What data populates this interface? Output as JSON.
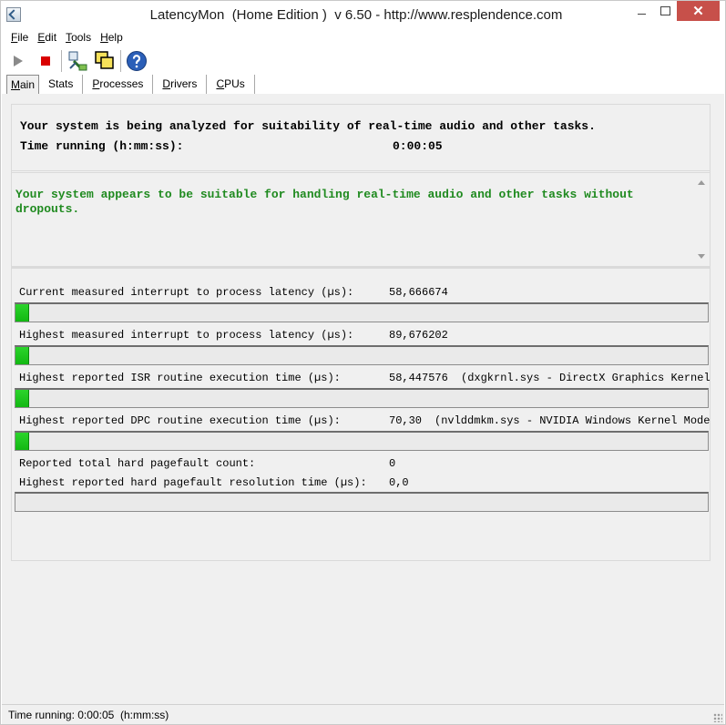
{
  "window": {
    "title": "LatencyMon  (Home Edition )  v 6.50 - http://www.resplendence.com",
    "close_label": "✕"
  },
  "menu": [
    {
      "underline": "F",
      "rest": "ile"
    },
    {
      "underline": "E",
      "rest": "dit"
    },
    {
      "underline": "T",
      "rest": "ools"
    },
    {
      "underline": "H",
      "rest": "elp"
    }
  ],
  "toolbar": {
    "icons": [
      "play-icon",
      "stop-icon",
      "connection-icon",
      "windows-icon",
      "help-icon"
    ],
    "stop_color": "#d90000"
  },
  "tabs": [
    {
      "underline": "M",
      "rest": "ain",
      "active": true
    },
    {
      "underline": "",
      "rest": "Stats",
      "active": false
    },
    {
      "underline": "P",
      "rest": "rocesses",
      "active": false
    },
    {
      "underline": "D",
      "rest": "rivers",
      "active": false
    },
    {
      "underline": "C",
      "rest": "PUs",
      "active": false
    }
  ],
  "analysis": {
    "line1": "Your system is being analyzed for suitability of real-time audio and other tasks.",
    "time_label": "Time running (h:mm:ss):",
    "time_value": "0:00:05"
  },
  "verdict": {
    "text": "Your system appears to be suitable for handling real-time audio and other tasks without dropouts.",
    "color": "#1f8a1f"
  },
  "metrics": [
    {
      "label": "Current measured interrupt to process latency (µs):",
      "value": "58,666674",
      "detail": "",
      "bar_fraction": 0.02
    },
    {
      "label": "Highest measured interrupt to process latency (µs):",
      "value": "89,676202",
      "detail": "",
      "bar_fraction": 0.02
    },
    {
      "label": "Highest reported ISR routine execution time (µs):",
      "value": "58,447576",
      "detail": "(dxgkrnl.sys - DirectX Graphics Kernel,",
      "bar_fraction": 0.02
    },
    {
      "label": "Highest reported DPC routine execution time (µs):",
      "value": "70,30",
      "detail": "(nvlddmkm.sys - NVIDIA Windows Kernel Mode Driver",
      "bar_fraction": 0.02
    }
  ],
  "pagefault": {
    "count_label": "Reported total hard pagefault count:",
    "count_value": "0",
    "time_label": "Highest reported hard pagefault resolution time (µs):",
    "time_value": "0,0",
    "bar_fraction": 0
  },
  "statusbar": {
    "text": "Time running: 0:00:05  (h:mm:ss)"
  }
}
